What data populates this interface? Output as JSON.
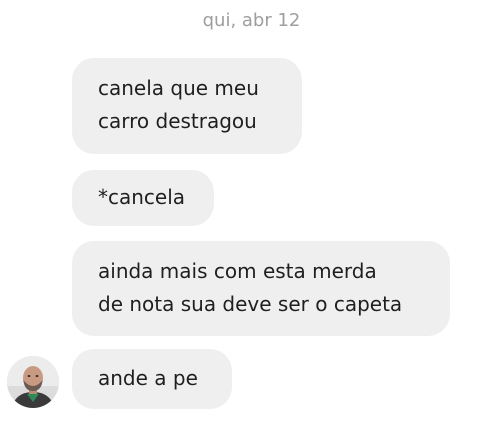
{
  "conversation": {
    "date_separator": "qui, abr 12",
    "messages": [
      {
        "lines": [
          "canela que meu",
          "carro destragou"
        ]
      },
      {
        "lines": [
          "*cancela"
        ]
      },
      {
        "lines": [
          "ainda mais com esta merda",
          "de nota sua deve ser o capeta"
        ]
      },
      {
        "lines": [
          "ande a pe"
        ]
      }
    ]
  },
  "colors": {
    "background": "#ffffff",
    "bubble": "#efefef",
    "text": "#1f1f1f",
    "date_text": "#9e9e9e",
    "avatar_shirt": "#2f8a5a"
  },
  "icons": {
    "avatar": "sender-avatar-photo"
  }
}
